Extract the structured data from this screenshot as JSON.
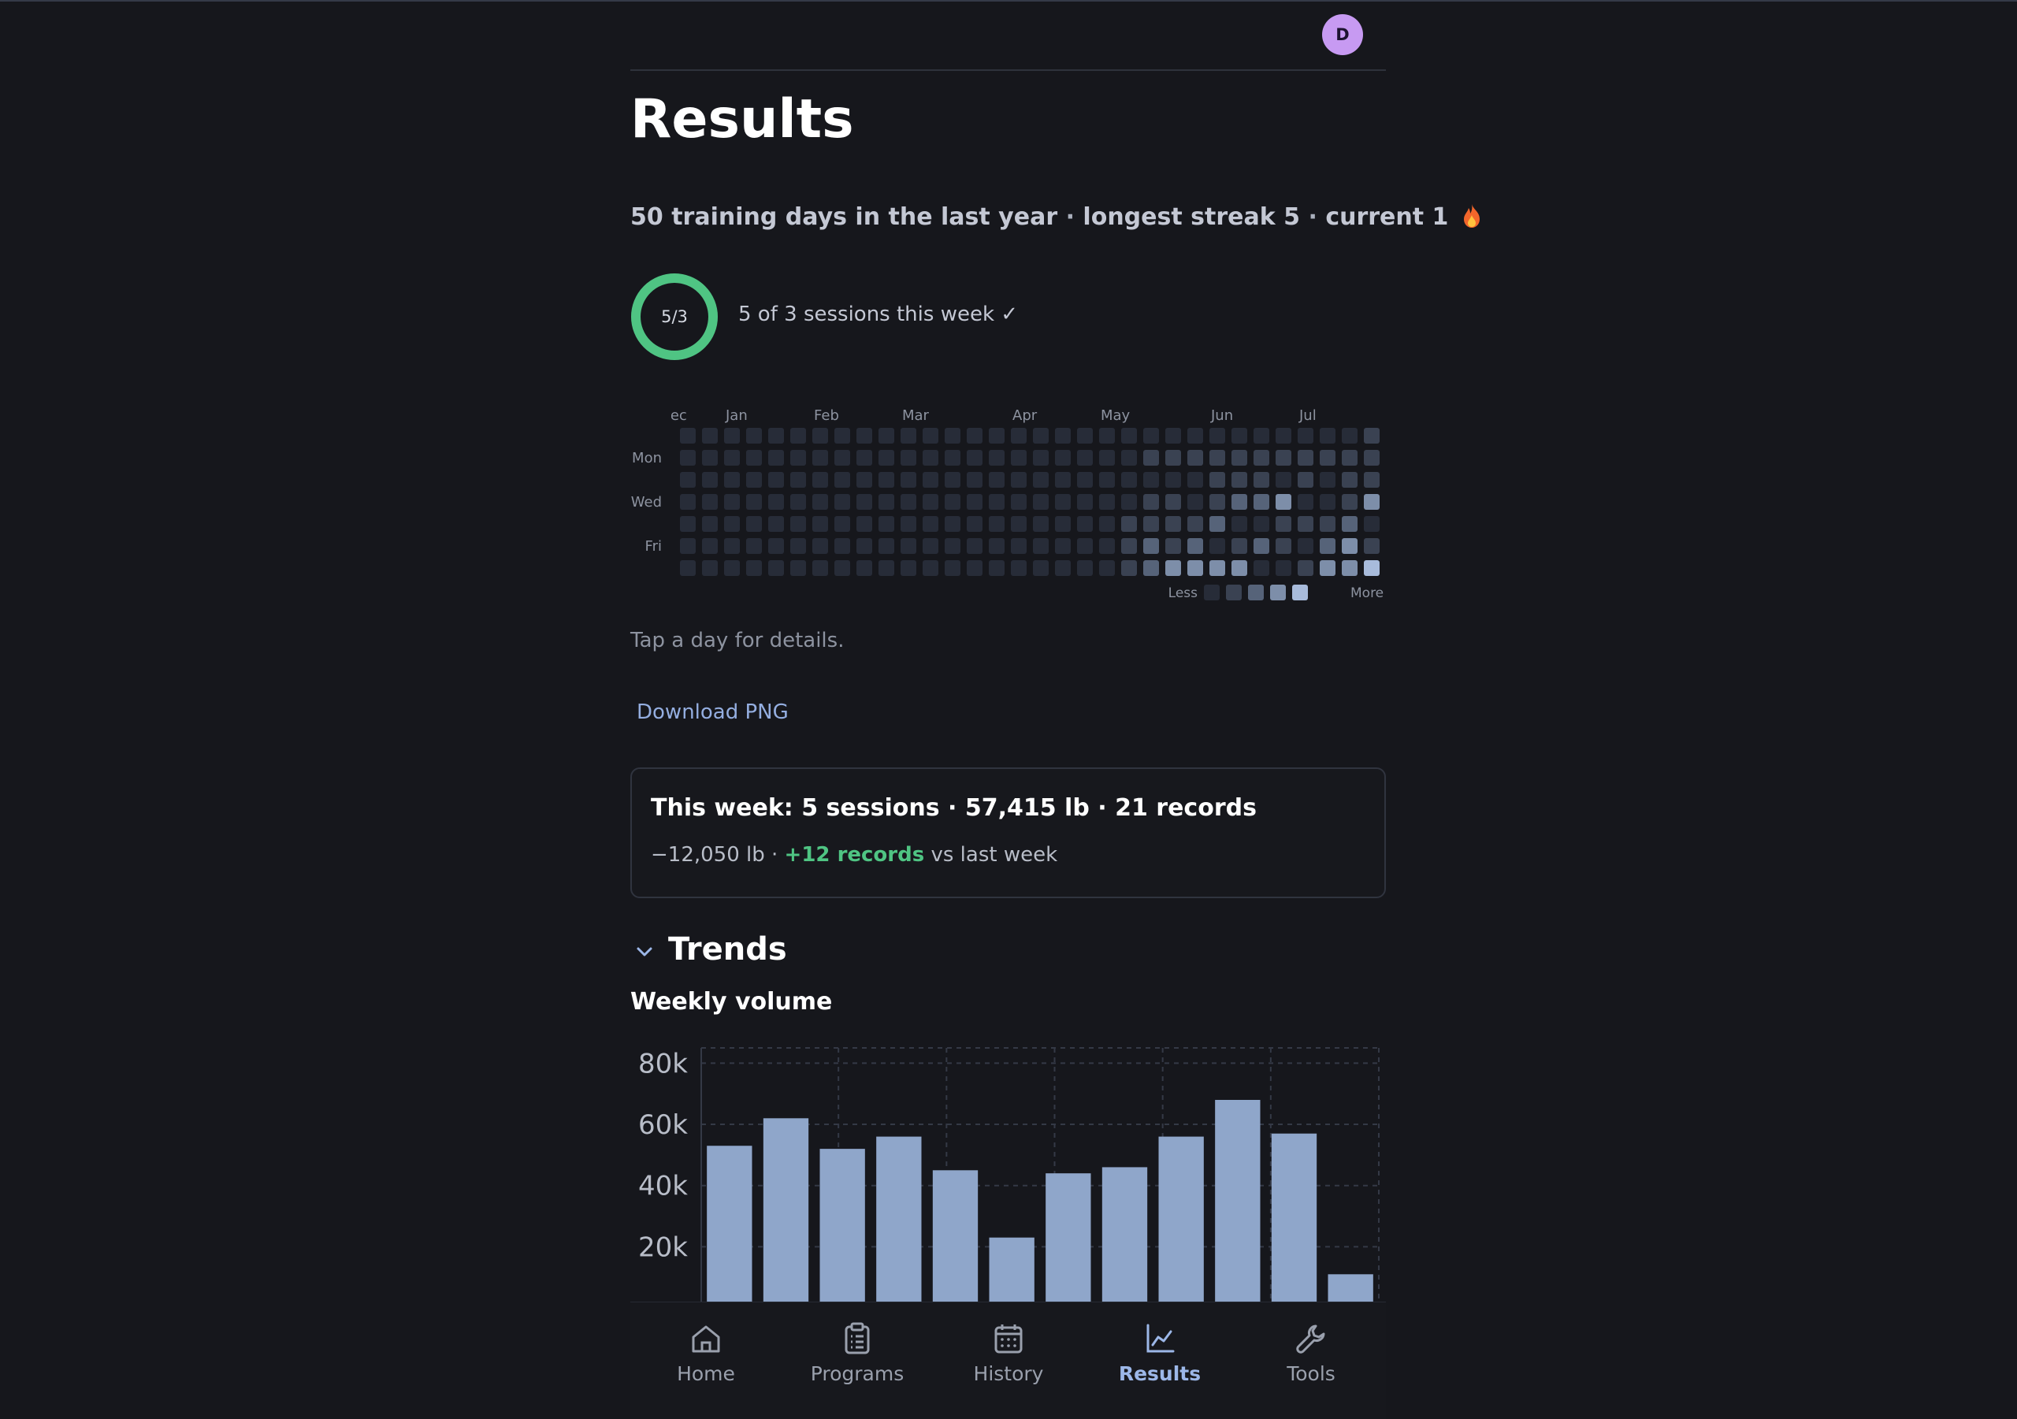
{
  "header": {
    "avatar_initial": "D"
  },
  "page": {
    "title": "Results"
  },
  "streak": {
    "training_days": "50 training days in the last year",
    "separator": "·",
    "longest": "longest streak 5",
    "current": "current 1",
    "fire_icon": "fire-icon"
  },
  "week_goal": {
    "ring_label": "5/3",
    "done": 5,
    "goal": 3,
    "text": "5 of 3 sessions this week ✓",
    "ring_color": "#4fc483"
  },
  "heatmap": {
    "months": [
      "Dec",
      "Jan",
      "Feb",
      "Mar",
      "Apr",
      "May",
      "Jun",
      "Jul"
    ],
    "day_labels": [
      "Mon",
      "Wed",
      "Fri"
    ],
    "legend_less": "Less",
    "legend_more": "More",
    "level_colors": [
      "#272c38",
      "#3a4252",
      "#566379",
      "#7d8ea9",
      "#a8bbdb"
    ],
    "weeks": 32,
    "month_start_weeks": [
      0,
      3,
      7,
      11,
      16,
      20,
      25,
      29
    ],
    "active_cells": [
      [
        20,
        4,
        1
      ],
      [
        20,
        5,
        1
      ],
      [
        20,
        6,
        1
      ],
      [
        21,
        1,
        1
      ],
      [
        21,
        3,
        1
      ],
      [
        21,
        4,
        1
      ],
      [
        21,
        5,
        2
      ],
      [
        21,
        6,
        2
      ],
      [
        22,
        1,
        1
      ],
      [
        22,
        3,
        1
      ],
      [
        22,
        4,
        1
      ],
      [
        22,
        5,
        1
      ],
      [
        22,
        6,
        3
      ],
      [
        23,
        1,
        1
      ],
      [
        23,
        4,
        1
      ],
      [
        23,
        5,
        2
      ],
      [
        23,
        6,
        3
      ],
      [
        24,
        1,
        1
      ],
      [
        24,
        2,
        1
      ],
      [
        24,
        3,
        1
      ],
      [
        24,
        4,
        2
      ],
      [
        24,
        6,
        3
      ],
      [
        25,
        1,
        1
      ],
      [
        25,
        2,
        1
      ],
      [
        25,
        3,
        2
      ],
      [
        25,
        5,
        1
      ],
      [
        25,
        6,
        3
      ],
      [
        26,
        1,
        1
      ],
      [
        26,
        2,
        1
      ],
      [
        26,
        3,
        2
      ],
      [
        26,
        5,
        2
      ],
      [
        27,
        1,
        1
      ],
      [
        27,
        3,
        3
      ],
      [
        27,
        4,
        1
      ],
      [
        27,
        5,
        1
      ],
      [
        28,
        1,
        1
      ],
      [
        28,
        2,
        1
      ],
      [
        28,
        4,
        1
      ],
      [
        28,
        6,
        1
      ],
      [
        29,
        1,
        1
      ],
      [
        29,
        4,
        1
      ],
      [
        29,
        5,
        2
      ],
      [
        29,
        6,
        3
      ],
      [
        30,
        1,
        1
      ],
      [
        30,
        2,
        1
      ],
      [
        30,
        3,
        1
      ],
      [
        30,
        4,
        2
      ],
      [
        30,
        5,
        3
      ],
      [
        30,
        6,
        3
      ],
      [
        31,
        0,
        1
      ],
      [
        31,
        1,
        1
      ],
      [
        31,
        2,
        1
      ],
      [
        31,
        3,
        3
      ],
      [
        31,
        5,
        1
      ],
      [
        31,
        6,
        4
      ],
      [
        32,
        0,
        1
      ],
      [
        32,
        1,
        1
      ],
      [
        32,
        2,
        1
      ],
      [
        32,
        3,
        2
      ],
      [
        32,
        4,
        1
      ],
      [
        32,
        5,
        2
      ],
      [
        32,
        6,
        2
      ],
      [
        33,
        0,
        1
      ],
      [
        33,
        1,
        1
      ],
      [
        33,
        2,
        2
      ]
    ],
    "last_week_rows": 3
  },
  "hint": "Tap a day for details.",
  "download_label": "Download PNG",
  "summary": {
    "line1": "This week: 5 sessions · 57,415 lb · 21 records",
    "delta_lb": "−12,050 lb · ",
    "delta_records": "+12 records",
    "vs": " vs last week"
  },
  "trends": {
    "label": "Trends",
    "chevron_icon": "chevron-down-icon"
  },
  "chart_data": {
    "type": "bar",
    "title": "Weekly volume",
    "xlabel": "",
    "ylabel": "",
    "ylim": [
      0,
      85000
    ],
    "yticks": [
      "20k",
      "40k",
      "60k",
      "80k"
    ],
    "ytick_values": [
      20000,
      40000,
      60000,
      80000
    ],
    "values": [
      53000,
      62000,
      52000,
      56000,
      45000,
      23000,
      44000,
      46000,
      56000,
      68000,
      57000,
      11000
    ],
    "bar_color": "#8fa6ca",
    "grid": true
  },
  "nav": [
    {
      "label": "Home",
      "icon": "home-icon",
      "active": false
    },
    {
      "label": "Programs",
      "icon": "clipboard-icon",
      "active": false
    },
    {
      "label": "History",
      "icon": "calendar-icon",
      "active": false
    },
    {
      "label": "Results",
      "icon": "chart-line-icon",
      "active": true
    },
    {
      "label": "Tools",
      "icon": "wrench-icon",
      "active": false
    }
  ]
}
